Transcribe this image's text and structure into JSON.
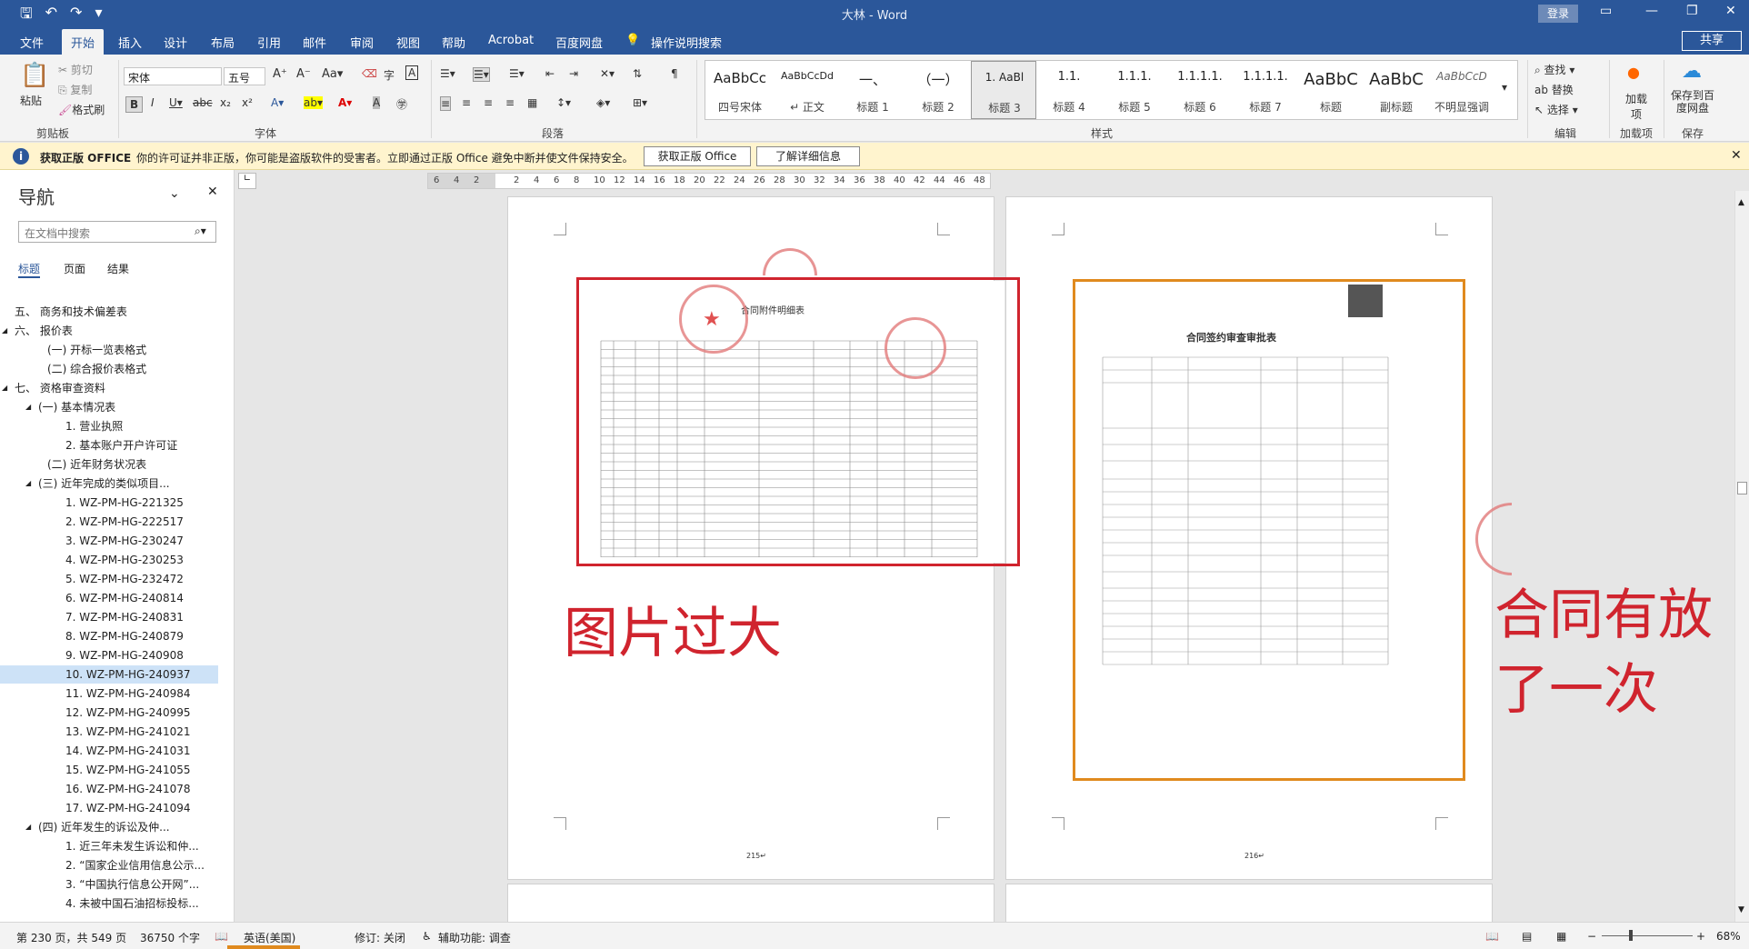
{
  "window": {
    "title": "大林 - Word",
    "login": "登录",
    "share": "共享"
  },
  "tabs": [
    "文件",
    "开始",
    "插入",
    "设计",
    "布局",
    "引用",
    "邮件",
    "审阅",
    "视图",
    "帮助",
    "Acrobat",
    "百度网盘"
  ],
  "tell_me": "操作说明搜索",
  "ribbon": {
    "clipboard": {
      "paste": "粘贴",
      "cut": "剪切",
      "copy": "复制",
      "format_painter": "格式刷",
      "label": "剪贴板"
    },
    "font": {
      "name": "宋体",
      "size": "五号",
      "label": "字体"
    },
    "paragraph": {
      "label": "段落"
    },
    "styles": {
      "label": "样式",
      "items": [
        {
          "preview": "AaBbCc",
          "name": "四号宋体"
        },
        {
          "preview": "AaBbCcDd",
          "name": "↵ 正文"
        },
        {
          "preview": "一、",
          "name": "标题 1"
        },
        {
          "preview": "（一）",
          "name": "标题 2"
        },
        {
          "preview": "1. AaBl",
          "name": "标题 3"
        },
        {
          "preview": "1.1.",
          "name": "标题 4"
        },
        {
          "preview": "1.1.1.",
          "name": "标题 5"
        },
        {
          "preview": "1.1.1.1.",
          "name": "标题 6"
        },
        {
          "preview": "1.1.1.1.",
          "name": "标题 7"
        },
        {
          "preview": "AaBbC",
          "name": "标题"
        },
        {
          "preview": "AaBbC",
          "name": "副标题"
        },
        {
          "preview": "AaBbCcD",
          "name": "不明显强调"
        }
      ]
    },
    "editing": {
      "find": "查找",
      "replace": "替换",
      "select": "选择",
      "label": "编辑"
    },
    "addins": {
      "button": "加载项",
      "label": "加载项"
    },
    "save": {
      "button": "保存到百度网盘",
      "label": "保存"
    }
  },
  "infobar": {
    "title": "获取正版 OFFICE",
    "message": "你的许可证并非正版，你可能是盗版软件的受害者。立即通过正版 Office 避免中断并使文件保持安全。",
    "btn_get": "获取正版 Office",
    "btn_more": "了解详细信息"
  },
  "nav": {
    "title": "导航",
    "search_placeholder": "在文档中搜索",
    "tabs": [
      "标题",
      "页面",
      "结果"
    ],
    "items": [
      {
        "text": "五、 商务和技术偏差表",
        "indent": 16,
        "arrow": ""
      },
      {
        "text": "六、 报价表",
        "indent": 16,
        "arrow": "◢"
      },
      {
        "text": "(一)  开标一览表格式",
        "indent": 52,
        "arrow": ""
      },
      {
        "text": "(二)  综合报价表格式",
        "indent": 52,
        "arrow": ""
      },
      {
        "text": "七、 资格审查资料",
        "indent": 16,
        "arrow": "◢"
      },
      {
        "text": "(一)  基本情况表",
        "indent": 42,
        "arrow": "◢"
      },
      {
        "text": "1. 营业执照",
        "indent": 72,
        "arrow": ""
      },
      {
        "text": "2. 基本账户开户许可证",
        "indent": 72,
        "arrow": ""
      },
      {
        "text": "(二)  近年财务状况表",
        "indent": 52,
        "arrow": ""
      },
      {
        "text": "(三)  近年完成的类似项目...",
        "indent": 42,
        "arrow": "◢"
      },
      {
        "text": "1. WZ-PM-HG-221325",
        "indent": 72,
        "arrow": ""
      },
      {
        "text": "2. WZ-PM-HG-222517",
        "indent": 72,
        "arrow": ""
      },
      {
        "text": "3. WZ-PM-HG-230247",
        "indent": 72,
        "arrow": ""
      },
      {
        "text": "4. WZ-PM-HG-230253",
        "indent": 72,
        "arrow": ""
      },
      {
        "text": "5. WZ-PM-HG-232472",
        "indent": 72,
        "arrow": ""
      },
      {
        "text": "6. WZ-PM-HG-240814",
        "indent": 72,
        "arrow": ""
      },
      {
        "text": "7. WZ-PM-HG-240831",
        "indent": 72,
        "arrow": ""
      },
      {
        "text": "8. WZ-PM-HG-240879",
        "indent": 72,
        "arrow": ""
      },
      {
        "text": "9. WZ-PM-HG-240908",
        "indent": 72,
        "arrow": ""
      },
      {
        "text": "10. WZ-PM-HG-240937",
        "indent": 72,
        "arrow": "",
        "selected": true
      },
      {
        "text": "11. WZ-PM-HG-240984",
        "indent": 72,
        "arrow": ""
      },
      {
        "text": "12. WZ-PM-HG-240995",
        "indent": 72,
        "arrow": ""
      },
      {
        "text": "13. WZ-PM-HG-241021",
        "indent": 72,
        "arrow": ""
      },
      {
        "text": "14. WZ-PM-HG-241031",
        "indent": 72,
        "arrow": ""
      },
      {
        "text": "15. WZ-PM-HG-241055",
        "indent": 72,
        "arrow": ""
      },
      {
        "text": "16. WZ-PM-HG-241078",
        "indent": 72,
        "arrow": ""
      },
      {
        "text": "17. WZ-PM-HG-241094",
        "indent": 72,
        "arrow": ""
      },
      {
        "text": "(四)  近年发生的诉讼及仲...",
        "indent": 42,
        "arrow": "◢"
      },
      {
        "text": "1. 近三年未发生诉讼和仲...",
        "indent": 72,
        "arrow": ""
      },
      {
        "text": "2. “国家企业信用信息公示...",
        "indent": 72,
        "arrow": ""
      },
      {
        "text": "3. “中国执行信息公开网”...",
        "indent": 72,
        "arrow": ""
      },
      {
        "text": "4. 未被中国石油招标投标...",
        "indent": 72,
        "arrow": ""
      }
    ]
  },
  "ruler_numbers": [
    "6",
    "4",
    "2",
    "",
    "2",
    "4",
    "6",
    "8",
    "10",
    "12",
    "14",
    "16",
    "18",
    "20",
    "22",
    "24",
    "26",
    "28",
    "30",
    "32",
    "34",
    "36",
    "38",
    "40",
    "42",
    "44",
    "46",
    "48"
  ],
  "doc": {
    "left_image_title": "合同附件明细表",
    "right_image_title": "合同签约审查审批表",
    "annotation_left": "图片过大",
    "annotation_right_1": "合同有放",
    "annotation_right_2": "了一次",
    "page_num_left": "215↵",
    "page_num_right": "216↵"
  },
  "status": {
    "page": "第 230 页，共 549 页",
    "words": "36750 个字",
    "lang": "英语(美国)",
    "track": "修订: 关闭",
    "access": "辅助功能: 调查",
    "zoom": "68%"
  },
  "colors": {
    "accent": "#2b579a",
    "annot_red": "#d0242e",
    "annot_orange": "#e08a1e",
    "info_bg": "#fff4ce"
  }
}
